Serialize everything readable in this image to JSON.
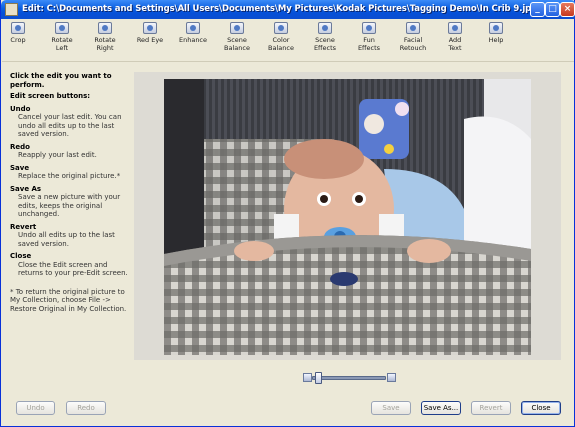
{
  "window": {
    "title": "Edit: C:\\Documents and Settings\\All Users\\Documents\\My Pictures\\Kodak Pictures\\Tagging Demo\\In Crib 9.jpg",
    "controls": {
      "minimize": "_",
      "maximize": "□",
      "close": "×"
    }
  },
  "toolbar": {
    "tools": [
      {
        "label": "Crop",
        "icon": "crop-icon"
      },
      {
        "label": "Rotate\nLeft",
        "icon": "rotate-left-icon"
      },
      {
        "label": "Rotate\nRight",
        "icon": "rotate-right-icon"
      },
      {
        "label": "Red Eye",
        "icon": "red-eye-icon"
      },
      {
        "label": "Enhance",
        "icon": "enhance-icon"
      },
      {
        "label": "Scene\nBalance",
        "icon": "scene-balance-icon"
      },
      {
        "label": "Color\nBalance",
        "icon": "color-balance-icon"
      },
      {
        "label": "Scene\nEffects",
        "icon": "scene-effects-icon"
      },
      {
        "label": "Fun\nEffects",
        "icon": "fun-effects-icon"
      },
      {
        "label": "Facial\nRetouch",
        "icon": "facial-retouch-icon"
      },
      {
        "label": "Add\nText",
        "icon": "add-text-icon"
      },
      {
        "label": "Help",
        "icon": "help-icon"
      }
    ]
  },
  "instructions": {
    "heading": "Click the edit you want to perform.",
    "subheading": "Edit screen buttons:",
    "items": [
      {
        "term": "Undo",
        "desc": "Cancel your last edit. You can undo all edits up to the last saved version."
      },
      {
        "term": "Redo",
        "desc": "Reapply your last edit."
      },
      {
        "term": "Save",
        "desc": "Replace the original picture.*"
      },
      {
        "term": "Save As",
        "desc": "Save a new picture with your edits, keeps the original unchanged."
      },
      {
        "term": "Revert",
        "desc": "Undo all edits up to the last saved version."
      },
      {
        "term": "Close",
        "desc": "Close the Edit screen and returns to your pre-Edit screen."
      }
    ],
    "note": "* To return the original picture to My Collection, choose File -> Restore Original in My Collection."
  },
  "zoom": {
    "level": 0.05
  },
  "buttons": {
    "undo": "Undo",
    "redo": "Redo",
    "save": "Save",
    "save_as": "Save As...",
    "revert": "Revert",
    "close": "Close"
  },
  "colors": {
    "titlebar": "#0a5ee0",
    "accent": "#316ac5"
  }
}
